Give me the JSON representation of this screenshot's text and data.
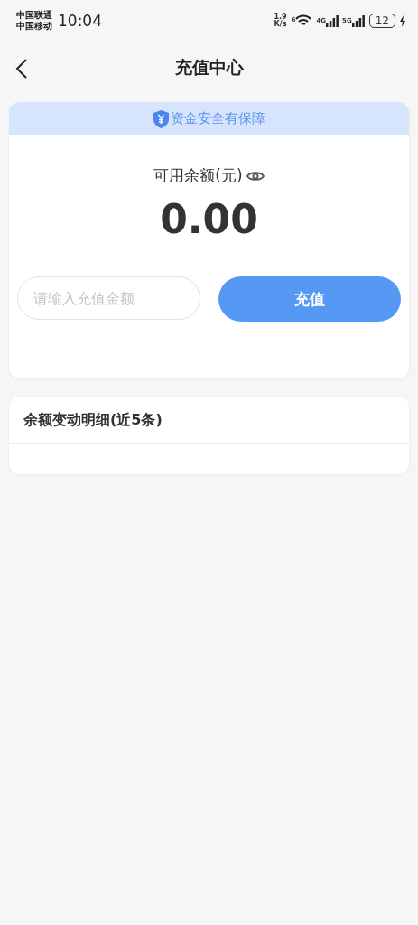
{
  "status_bar": {
    "carriers": [
      "中国联通",
      "中国移动"
    ],
    "time": "10:04",
    "net_speed": "1.9",
    "net_speed_unit": "K/s",
    "wifi_label": "6",
    "signals": [
      {
        "label": "4G"
      },
      {
        "label": "5G"
      }
    ],
    "battery": "12"
  },
  "nav": {
    "title": "充值中心"
  },
  "balance_card": {
    "banner": "资金安全有保障",
    "label": "可用余额(元)",
    "amount": "0.00",
    "amount_field": {
      "placeholder": "请输入充值金额"
    },
    "recharge_button": "充值"
  },
  "details_card": {
    "title": "余额变动明细(近5条)"
  }
}
